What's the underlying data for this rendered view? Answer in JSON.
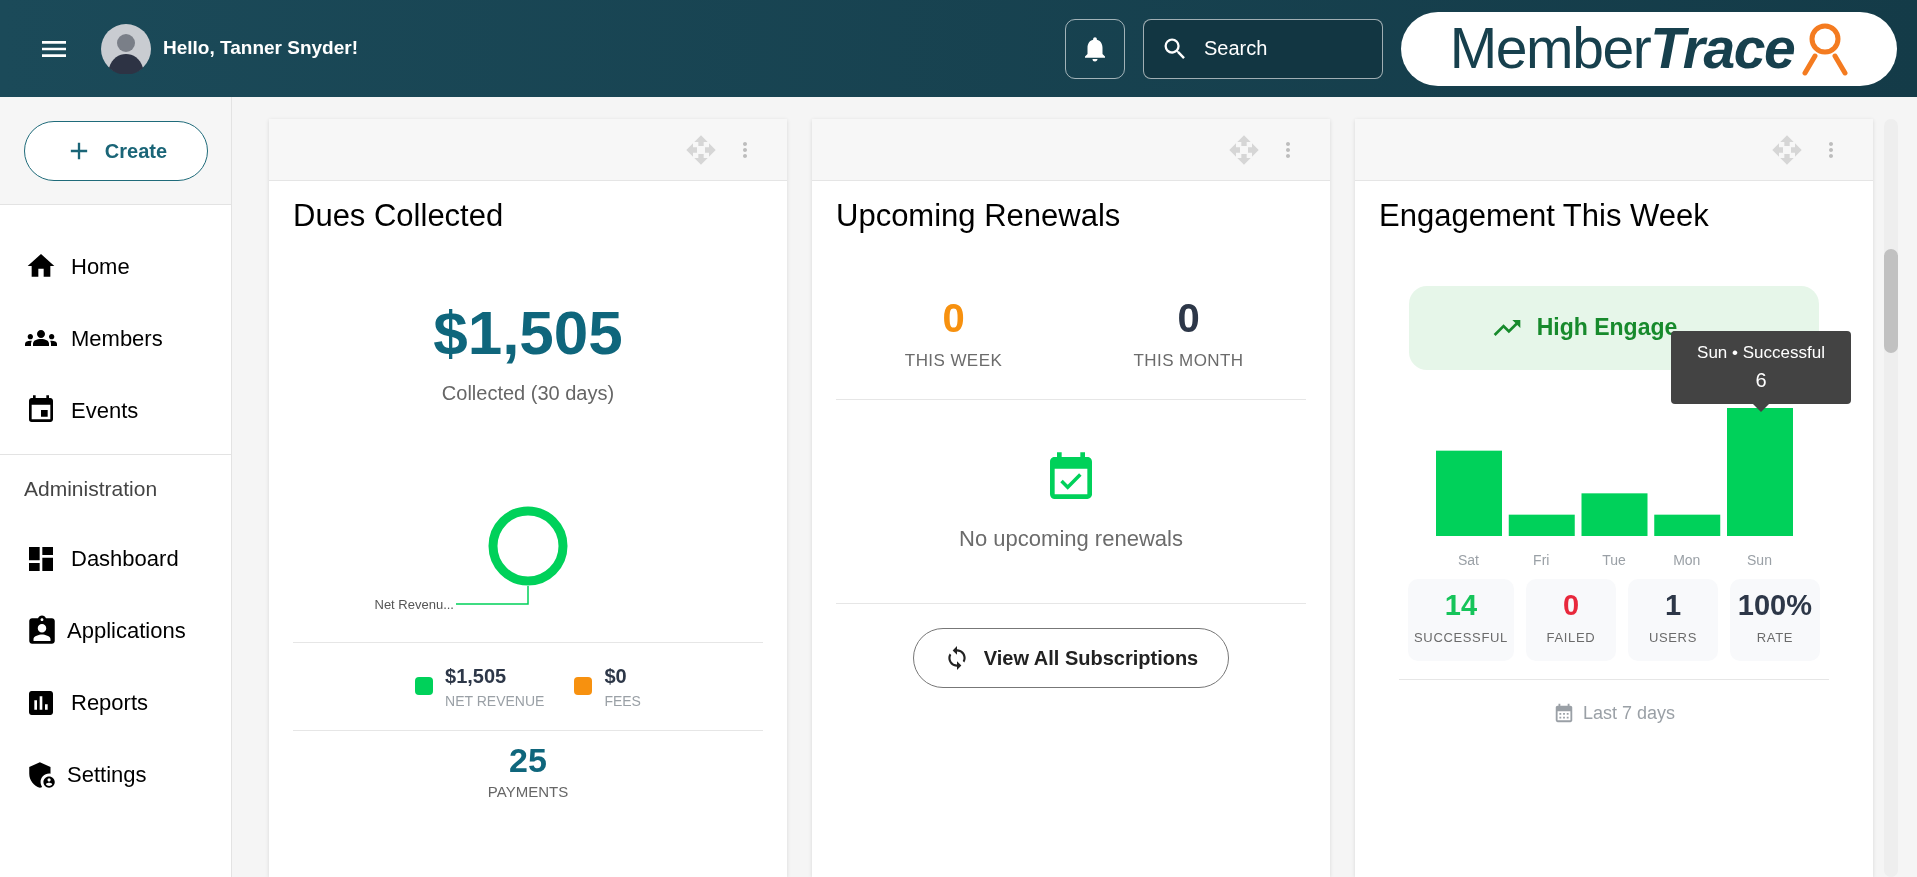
{
  "header": {
    "greeting": "Hello, Tanner Snyder!",
    "search": {
      "placeholder": "Search"
    },
    "logo": {
      "word_1": "Member",
      "word_2": "Trace"
    }
  },
  "sidebar": {
    "create_button": "Create",
    "items": [
      {
        "label": "Home"
      },
      {
        "label": "Members"
      },
      {
        "label": "Events"
      }
    ],
    "section_heading": "Administration",
    "admin_items": [
      {
        "label": "Dashboard"
      },
      {
        "label": "Applications"
      },
      {
        "label": "Reports"
      },
      {
        "label": "Settings"
      }
    ]
  },
  "dues_card": {
    "title": "Dues Collected",
    "amount": "$1,505",
    "amount_caption": "Collected (30 days)",
    "donut_label": "Net Revenu...",
    "legend": [
      {
        "value": "$1,505",
        "label": "NET REVENUE",
        "color": "#00d15a"
      },
      {
        "value": "$0",
        "label": "FEES",
        "color": "#f7910f"
      }
    ],
    "payments": {
      "value": "25",
      "label": "PAYMENTS"
    }
  },
  "renewals_card": {
    "title": "Upcoming Renewals",
    "stats": [
      {
        "value": "0",
        "label": "THIS WEEK",
        "color": "#f7910f"
      },
      {
        "value": "0",
        "label": "THIS MONTH",
        "color": "#2d3748"
      }
    ],
    "empty_message": "No upcoming renewals",
    "button": "View All Subscriptions"
  },
  "engagement_card": {
    "title": "Engagement This Week",
    "banner": "High Engage",
    "day_labels": [
      "Sat",
      "Fri",
      "Tue",
      "Mon",
      "Sun"
    ],
    "tooltip": {
      "title": "Sun • Successful",
      "value": "6"
    },
    "stats": [
      {
        "value": "14",
        "label": "SUCCESSFUL",
        "color": "#16c45a"
      },
      {
        "value": "0",
        "label": "FAILED",
        "color": "#e8283c"
      },
      {
        "value": "1",
        "label": "USERS",
        "color": "#2d3748"
      },
      {
        "value": "100%",
        "label": "RATE",
        "color": "#2d3748"
      }
    ],
    "footer": "Last 7 days"
  }
}
